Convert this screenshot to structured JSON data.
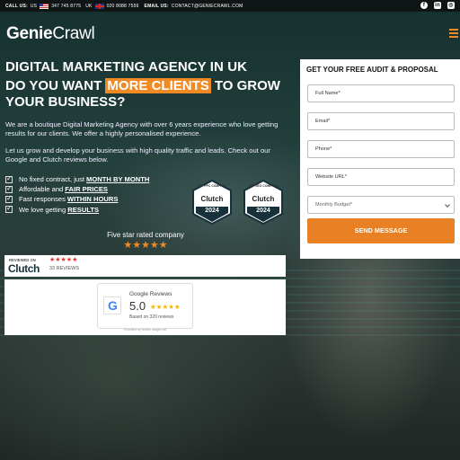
{
  "topbar": {
    "call_label": "CALL US:",
    "us_label": "US",
    "us_phone": "347 745 8775",
    "uk_label": "UK",
    "uk_phone": "020 8088 7559",
    "email_label": "EMAIL US:",
    "email": "CONTACT@GENIECRAWL.COM",
    "social_icons": [
      "facebook-icon",
      "linkedin-icon",
      "instagram-icon"
    ]
  },
  "header": {
    "logo_bold": "Genie",
    "logo_light": "Crawl"
  },
  "hero": {
    "heading": "DIGITAL MARKETING AGENCY IN UK",
    "subheading_before": "DO YOU WANT ",
    "subheading_highlight": "MORE CLIENTS",
    "subheading_after": " TO GROW YOUR BUSINESS?",
    "paragraph1": "We are a boutique Digital Marketing Agency with over 6 years experience who love getting results for our clients. We offer a highly personalised experience.",
    "paragraph2": "Let us grow and develop your business with high quality traffic and leads. Check out our Google and Clutch reviews below.",
    "checks": [
      {
        "text": "No fixed contract, just",
        "bold": "MONTH BY MONTH"
      },
      {
        "text": "Affordable and",
        "bold": "FAIR PRICES"
      },
      {
        "text": "Fast responses",
        "bold": "WITHIN HOURS"
      },
      {
        "text": "We love getting",
        "bold": "RESULTS"
      }
    ]
  },
  "badges": [
    {
      "top": "TOP PPC COMPANY",
      "brand": "Clutch",
      "year": "2024"
    },
    {
      "top": "TOP SEO COMPANY",
      "brand": "Clutch",
      "year": "2024"
    }
  ],
  "rating": {
    "label": "Five star rated company",
    "stars": "★★★★★"
  },
  "clutch": {
    "reviewed_on": "REVIEWED ON",
    "stars": "★★★★★",
    "name": "Clutch",
    "count": "33 REVIEWS"
  },
  "google": {
    "title": "Google Reviews",
    "score": "5.0",
    "stars": "★★★★★",
    "based_on": "Based on 320 reviews",
    "provided_by": "Provided by review widget.net"
  },
  "form": {
    "title": "GET YOUR FREE AUDIT & PROPOSAL",
    "fields": [
      "Full Name*",
      "Email*",
      "Phone*",
      "Website URL*"
    ],
    "budget_placeholder": "Monthly Budget*",
    "submit": "SEND MESSAGE"
  },
  "colors": {
    "accent": "#f08a24",
    "dark_bar": "#0f1515"
  }
}
